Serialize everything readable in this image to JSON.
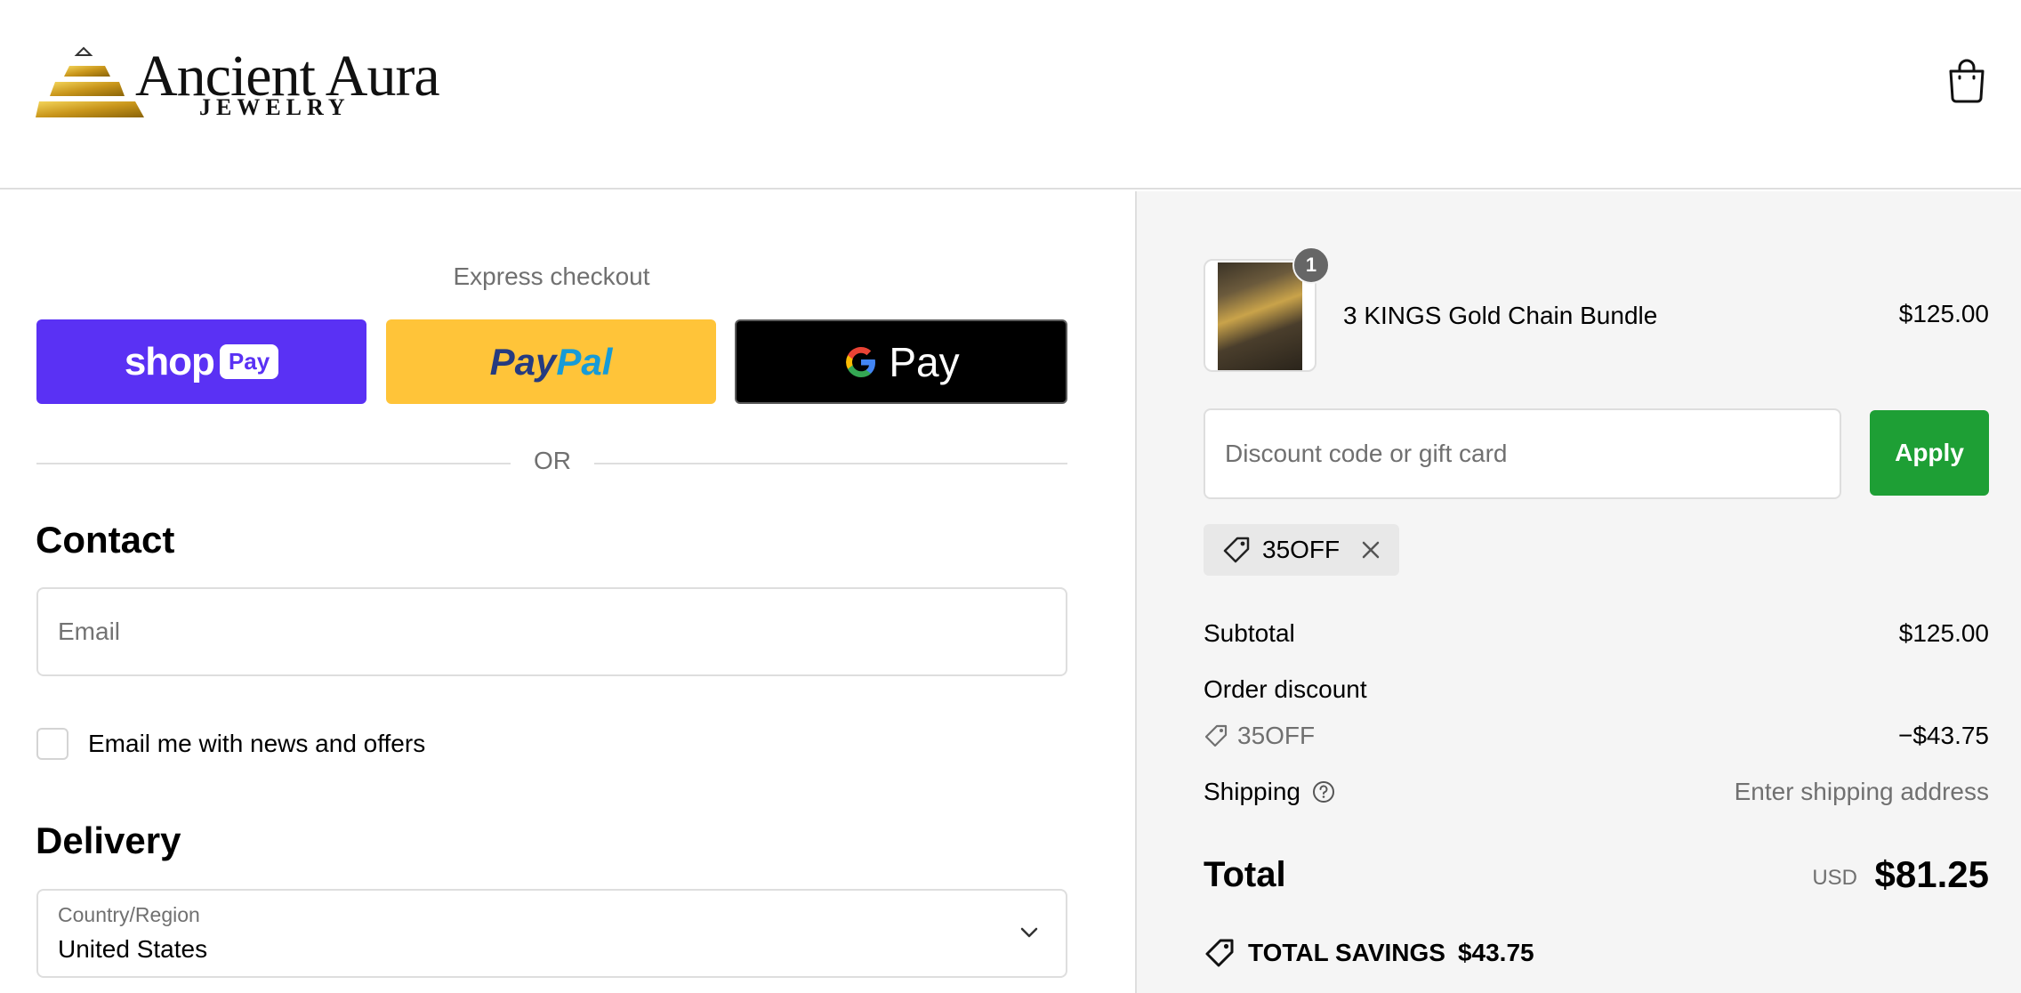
{
  "header": {
    "logo_title": "Ancient Aura",
    "logo_subtitle": "JEWELRY",
    "cart_icon": "shopping-bag-icon"
  },
  "express": {
    "title": "Express checkout",
    "shop_pay_label": "shop",
    "shop_pay_badge": "Pay",
    "paypal_label_1": "Pay",
    "paypal_label_2": "Pal",
    "gpay_label": "Pay",
    "or_label": "OR"
  },
  "contact": {
    "heading": "Contact",
    "email_placeholder": "Email",
    "email_value": "",
    "newsletter_label": "Email me with news and offers",
    "newsletter_checked": false
  },
  "delivery": {
    "heading": "Delivery",
    "country_label": "Country/Region",
    "country_value": "United States"
  },
  "cart": {
    "items": [
      {
        "name": "3 KINGS Gold Chain Bundle",
        "price": "$125.00",
        "quantity": "1"
      }
    ]
  },
  "discount": {
    "placeholder": "Discount code or gift card",
    "value": "",
    "apply_label": "Apply",
    "applied_code": "35OFF"
  },
  "summary": {
    "subtotal_label": "Subtotal",
    "subtotal_value": "$125.00",
    "order_discount_label": "Order discount",
    "discount_code": "35OFF",
    "discount_value": "−$43.75",
    "shipping_label": "Shipping",
    "shipping_value": "Enter shipping address",
    "total_label": "Total",
    "total_currency": "USD",
    "total_value": "$81.25",
    "savings_label": "TOTAL SAVINGS",
    "savings_value": "$43.75"
  },
  "colors": {
    "shop_pay": "#5a31f4",
    "paypal": "#ffc439",
    "apply_button": "#1e9f35",
    "summary_bg": "#f5f5f5"
  }
}
